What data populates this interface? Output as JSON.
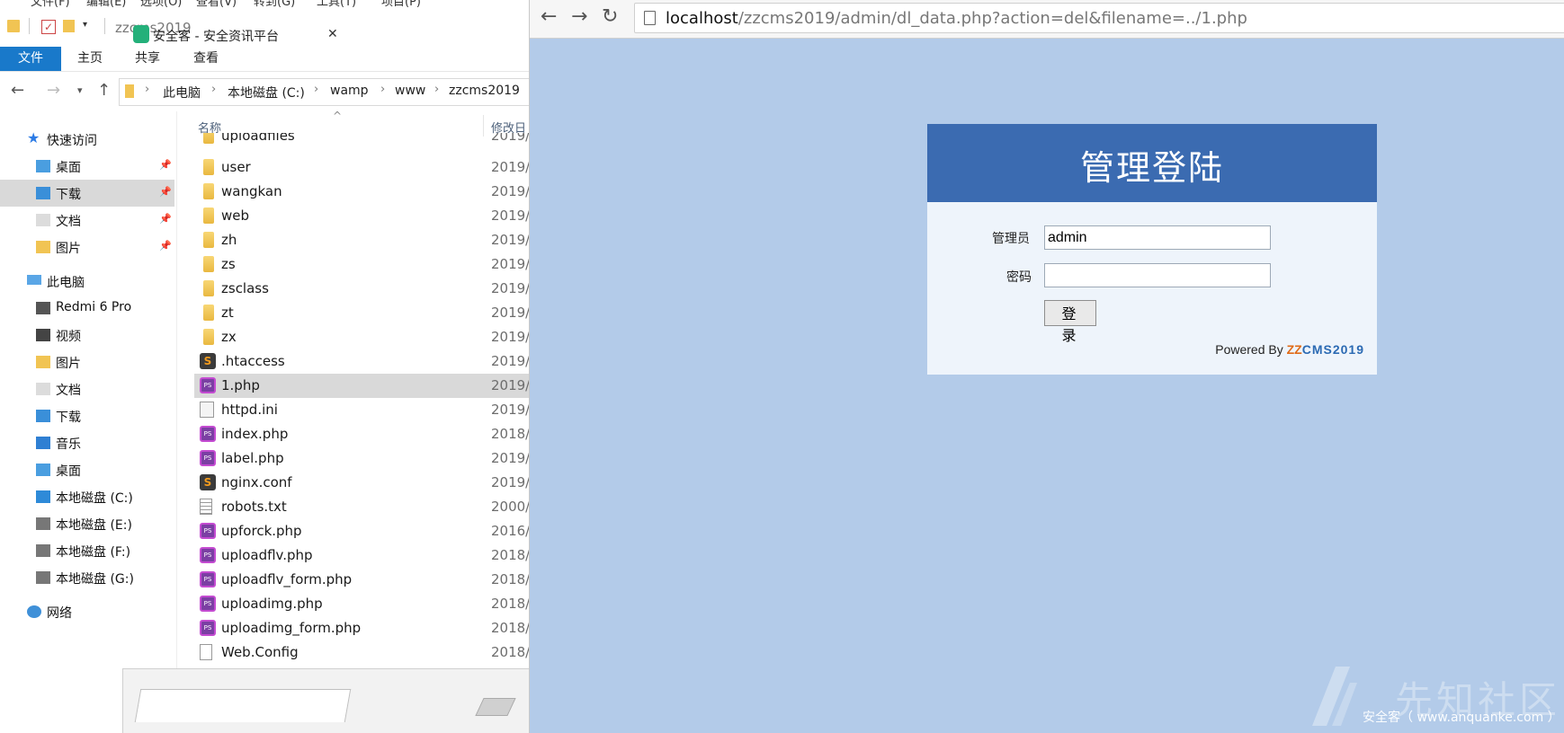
{
  "explorer": {
    "menu_strip": [
      "文件(F)",
      "编辑(E)",
      "选项(O)",
      "查看(V)",
      "转到(G)",
      "工具(T)",
      "项目(P)"
    ],
    "window_title": "zzcms2019",
    "ribbon_tabs": [
      "文件",
      "主页",
      "共享",
      "查看"
    ],
    "breadcrumb": [
      "此电脑",
      "本地磁盘 (C:)",
      "wamp",
      "www",
      "zzcms2019"
    ],
    "column_name": "名称",
    "column_date": "修改日",
    "nav": {
      "quick_access": "快速访问",
      "quick_items": [
        {
          "label": "桌面",
          "icon": "desktop-folder-icon"
        },
        {
          "label": "下载",
          "icon": "download-folder-icon"
        },
        {
          "label": "文档",
          "icon": "documents-folder-icon"
        },
        {
          "label": "图片",
          "icon": "pictures-folder-icon"
        }
      ],
      "this_pc": "此电脑",
      "pc_items": [
        {
          "label": "Redmi 6 Pro",
          "icon": "phone-icon"
        },
        {
          "label": "视频",
          "icon": "videos-folder-icon"
        },
        {
          "label": "图片",
          "icon": "pictures-folder-icon"
        },
        {
          "label": "文档",
          "icon": "documents-folder-icon"
        },
        {
          "label": "下载",
          "icon": "download-folder-icon"
        },
        {
          "label": "音乐",
          "icon": "music-folder-icon"
        },
        {
          "label": "桌面",
          "icon": "desktop-folder-icon"
        },
        {
          "label": "本地磁盘 (C:)",
          "icon": "windows-drive-icon"
        },
        {
          "label": "本地磁盘 (E:)",
          "icon": "drive-icon"
        },
        {
          "label": "本地磁盘 (F:)",
          "icon": "drive-icon"
        },
        {
          "label": "本地磁盘 (G:)",
          "icon": "drive-icon"
        }
      ],
      "network": "网络"
    },
    "files": [
      {
        "name": "uploadfiles",
        "date": "2019/",
        "type": "folder"
      },
      {
        "name": "user",
        "date": "2019/",
        "type": "folder"
      },
      {
        "name": "wangkan",
        "date": "2019/",
        "type": "folder"
      },
      {
        "name": "web",
        "date": "2019/",
        "type": "folder"
      },
      {
        "name": "zh",
        "date": "2019/",
        "type": "folder"
      },
      {
        "name": "zs",
        "date": "2019/",
        "type": "folder"
      },
      {
        "name": "zsclass",
        "date": "2019/",
        "type": "folder"
      },
      {
        "name": "zt",
        "date": "2019/",
        "type": "folder"
      },
      {
        "name": "zx",
        "date": "2019/",
        "type": "folder"
      },
      {
        "name": ".htaccess",
        "date": "2019/",
        "type": "sublime"
      },
      {
        "name": "1.php",
        "date": "2019/",
        "type": "php",
        "selected": true
      },
      {
        "name": "httpd.ini",
        "date": "2019/",
        "type": "ini"
      },
      {
        "name": "index.php",
        "date": "2018/",
        "type": "php"
      },
      {
        "name": "label.php",
        "date": "2019/",
        "type": "php"
      },
      {
        "name": "nginx.conf",
        "date": "2019/",
        "type": "sublime"
      },
      {
        "name": "robots.txt",
        "date": "2000/",
        "type": "txt"
      },
      {
        "name": "upforck.php",
        "date": "2016/",
        "type": "php"
      },
      {
        "name": "uploadflv.php",
        "date": "2018/",
        "type": "php"
      },
      {
        "name": "uploadflv_form.php",
        "date": "2018/",
        "type": "php"
      },
      {
        "name": "uploadimg.php",
        "date": "2018/",
        "type": "php"
      },
      {
        "name": "uploadimg_form.php",
        "date": "2018/",
        "type": "php"
      },
      {
        "name": "Web.Config",
        "date": "2018/",
        "type": "file"
      }
    ],
    "mini_browser_tab": "安全客 - 安全资讯平台"
  },
  "browser": {
    "url_host": "localhost",
    "url_path": "/zzcms2019/admin/dl_data.php?action=del&filename=../1.php",
    "login": {
      "title": "管理登陆",
      "admin_label": "管理员",
      "admin_value": "admin",
      "password_label": "密码",
      "password_value": "",
      "button": "登 录",
      "powered_by": "Powered By ",
      "brand_zz": "ZZ",
      "brand_cms": "CMS2019"
    },
    "watermark_text": "先知社区",
    "watermark_sub": "安全客（ www.anquanke.com ）",
    "colors": {
      "page_bg": "#b3cbe9",
      "header": "#3b6bb1",
      "panel": "#eef4fb",
      "brand_zz": "#e06a16",
      "brand_cms": "#2b6ab3"
    }
  }
}
